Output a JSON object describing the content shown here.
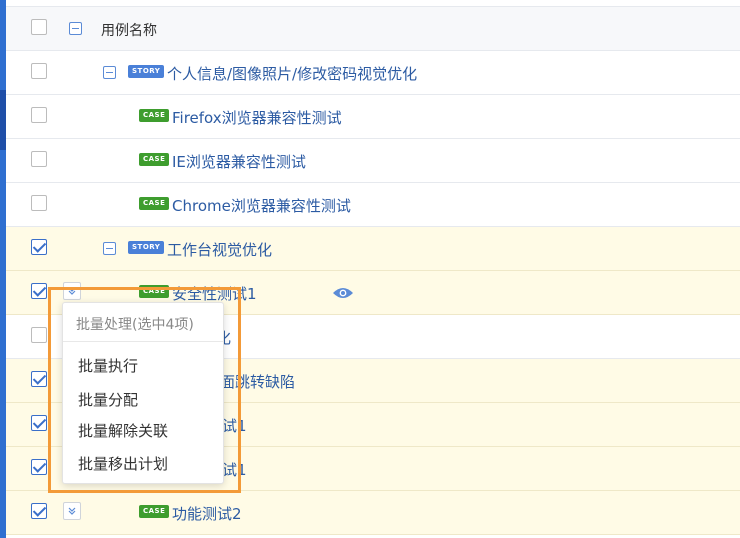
{
  "header": {
    "title": "用例名称"
  },
  "rows": [
    {
      "type": "story",
      "badge": "STORY",
      "label": "个人信息/图像照片/修改密码视觉优化",
      "checked": false
    },
    {
      "type": "case",
      "badge": "CASE",
      "label": "Firefox浏览器兼容性测试",
      "checked": false
    },
    {
      "type": "case",
      "badge": "CASE",
      "label": "IE浏览器兼容性测试",
      "checked": false
    },
    {
      "type": "case",
      "badge": "CASE",
      "label": "Chrome浏览器兼容性测试",
      "checked": false
    },
    {
      "type": "story",
      "badge": "STORY",
      "label": "工作台视觉优化",
      "checked": true
    },
    {
      "type": "case",
      "badge": "CASE",
      "label": "安全性测试1",
      "checked": true
    },
    {
      "type": "partial",
      "label": "化",
      "checked": false
    },
    {
      "type": "partial",
      "label": "面跳转缺陷",
      "checked": true
    },
    {
      "type": "partial",
      "label": "试1",
      "checked": true
    },
    {
      "type": "partial",
      "label": "试1",
      "checked": true
    },
    {
      "type": "case",
      "badge": "CASE",
      "label": "功能测试2",
      "checked": true
    }
  ],
  "popup": {
    "title": "批量处理(选中4项)",
    "items": [
      "批量执行",
      "批量分配",
      "批量解除关联",
      "批量移出计划"
    ]
  },
  "colors": {
    "accent": "#2c5ba3",
    "highlight": "#f39a38",
    "selected_row": "#fffbe6"
  }
}
